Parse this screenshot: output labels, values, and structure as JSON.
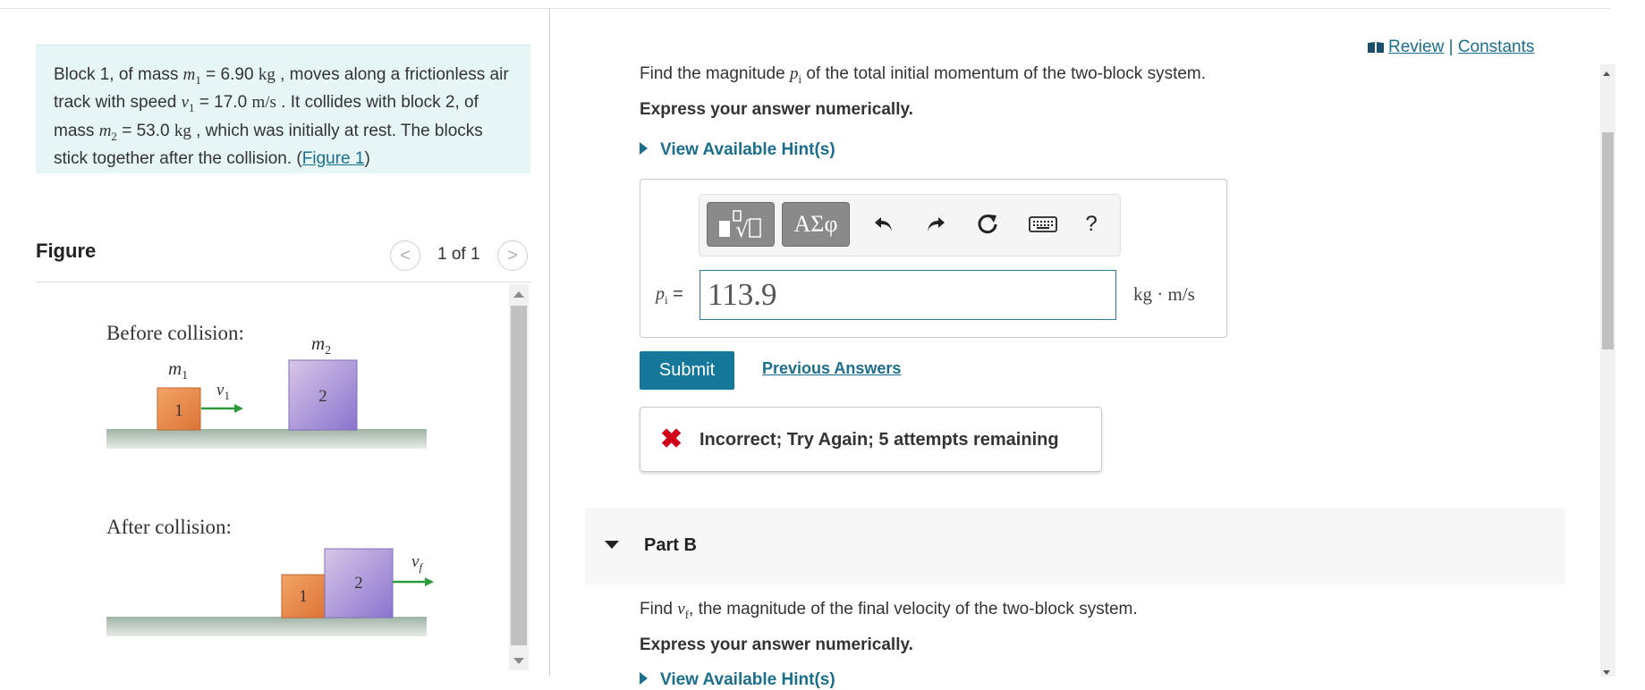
{
  "problem": {
    "text_parts": {
      "a": "Block 1, of mass ",
      "m1_sym": "m",
      "m1_sub": "1",
      "m1_val": " = 6.90 ",
      "m1_unit": "kg",
      "b": " , moves along a frictionless air track with speed ",
      "v1_sym": "v",
      "v1_sub": "1",
      "v1_val": " = 17.0 ",
      "v1_unit": "m/s",
      "c": " . It collides with block 2, of mass ",
      "m2_sym": "m",
      "m2_sub": "2",
      "m2_val": " = 53.0 ",
      "m2_unit": "kg",
      "d": " , which was initially at rest. The blocks stick together after the collision. (",
      "link": "Figure 1",
      "e": ")"
    }
  },
  "figure": {
    "title": "Figure",
    "pager": "1 of 1",
    "prev_glyph": "<",
    "next_glyph": ">",
    "before_label": "Before collision:",
    "after_label": "After collision:",
    "m1_label": "m",
    "m1_sub": "1",
    "m2_label": "m",
    "m2_sub": "2",
    "v1_label": "v",
    "v1_sub": "1",
    "vf_label": "v",
    "vf_sub": "f",
    "block1": "1",
    "block2": "2",
    "colors": {
      "block1": "#e8884a",
      "block2": "#a98fd6",
      "arrow": "#2e9a3c",
      "track": "#a6b8ab"
    }
  },
  "links": {
    "review": "Review",
    "separator": "|",
    "constants": "Constants"
  },
  "partA": {
    "question_pre": "Find the magnitude ",
    "question_sym": "p",
    "question_sub": "i",
    "question_post": " of the total initial momentum of the two-block system.",
    "instruction": "Express your answer numerically.",
    "hint": "View Available Hint(s)",
    "toolbar": {
      "templates_icon": "templates-icon",
      "greek": "ΑΣφ",
      "undo_icon": "undo-icon",
      "redo_icon": "redo-icon",
      "reset_icon": "reset-icon",
      "keyboard_icon": "keyboard-icon",
      "help": "?"
    },
    "input_label_sym": "p",
    "input_label_sub": "i",
    "input_label_eq": " =",
    "answer_value": "113.9",
    "units": "kg · m/s",
    "submit": "Submit",
    "previous": "Previous Answers",
    "feedback": "Incorrect; Try Again; 5 attempts remaining"
  },
  "partB": {
    "title": "Part B",
    "question_pre": "Find ",
    "question_sym": "v",
    "question_sub": "f",
    "question_post": ", the magnitude of the final velocity of the two-block system.",
    "instruction": "Express your answer numerically.",
    "hint": "View Available Hint(s)"
  }
}
